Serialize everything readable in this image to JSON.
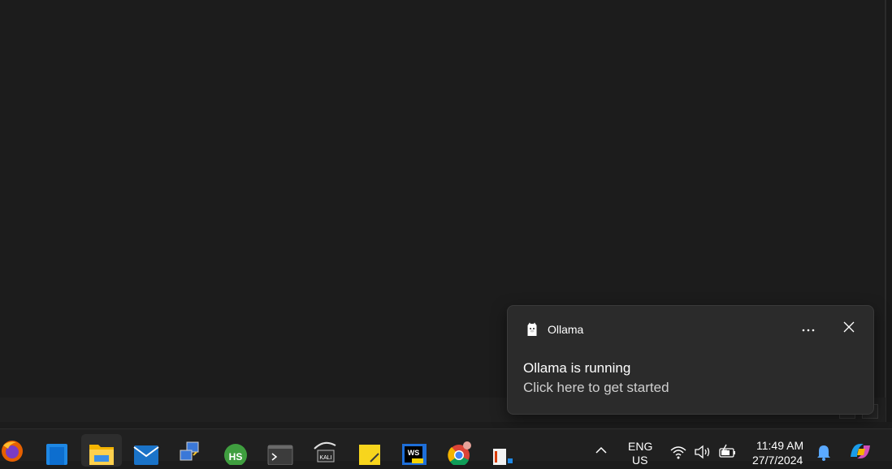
{
  "notification": {
    "app_name": "Ollama",
    "title": "Ollama is running",
    "body": "Click here to get started",
    "more_icon": "ellipsis-icon",
    "close_icon": "close-icon"
  },
  "taskbar": {
    "pinned_apps": [
      {
        "name": "firefox"
      },
      {
        "name": "azure-devops"
      },
      {
        "name": "file-explorer",
        "active": true
      },
      {
        "name": "mail"
      },
      {
        "name": "network-connections"
      },
      {
        "name": "hs-app"
      },
      {
        "name": "terminal"
      },
      {
        "name": "kali-linux"
      },
      {
        "name": "sticky-notes"
      },
      {
        "name": "webstorm"
      },
      {
        "name": "chrome"
      },
      {
        "name": "office-app"
      }
    ],
    "tray": {
      "language": "ENG",
      "region": "US",
      "time": "11:49 AM",
      "date": "27/7/2024"
    }
  },
  "colors": {
    "desktop": "#1c1c1c",
    "taskbar": "#202020",
    "toast": "#2b2b2b",
    "accent": "#0078d4"
  }
}
